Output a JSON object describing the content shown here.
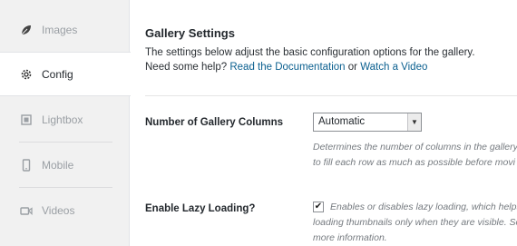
{
  "sidebar": {
    "tabs": [
      {
        "label": "Images",
        "icon": "leaf-icon",
        "active": false
      },
      {
        "label": "Config",
        "icon": "gear-icon",
        "active": true
      },
      {
        "label": "Lightbox",
        "icon": "lightbox-icon",
        "active": false
      },
      {
        "label": "Mobile",
        "icon": "mobile-icon",
        "active": false
      },
      {
        "label": "Videos",
        "icon": "video-icon",
        "active": false
      }
    ]
  },
  "main": {
    "title": "Gallery Settings",
    "description": "The settings below adjust the basic configuration options for the gallery.",
    "help_prefix": "Need some help?",
    "doc_link": "Read the Documentation",
    "or_text": "or",
    "video_link": "Watch a Video",
    "columns": {
      "label": "Number of Gallery Columns",
      "value": "Automatic",
      "help_line1": "Determines the number of columns in the gallery",
      "help_line2": "to fill each row as much as possible before movi"
    },
    "lazy": {
      "label": "Enable Lazy Loading?",
      "checked": true,
      "check_mark": "✔",
      "help_line1": "Enables or disables lazy loading, which helps",
      "help_line2": "loading thumbnails only when they are visible. Se",
      "help_line3": "more information."
    }
  },
  "colors": {
    "link": "#0a5f8f",
    "sidebar_bg": "#f1f1f1",
    "inactive_tab_text": "#9a9fa4"
  }
}
